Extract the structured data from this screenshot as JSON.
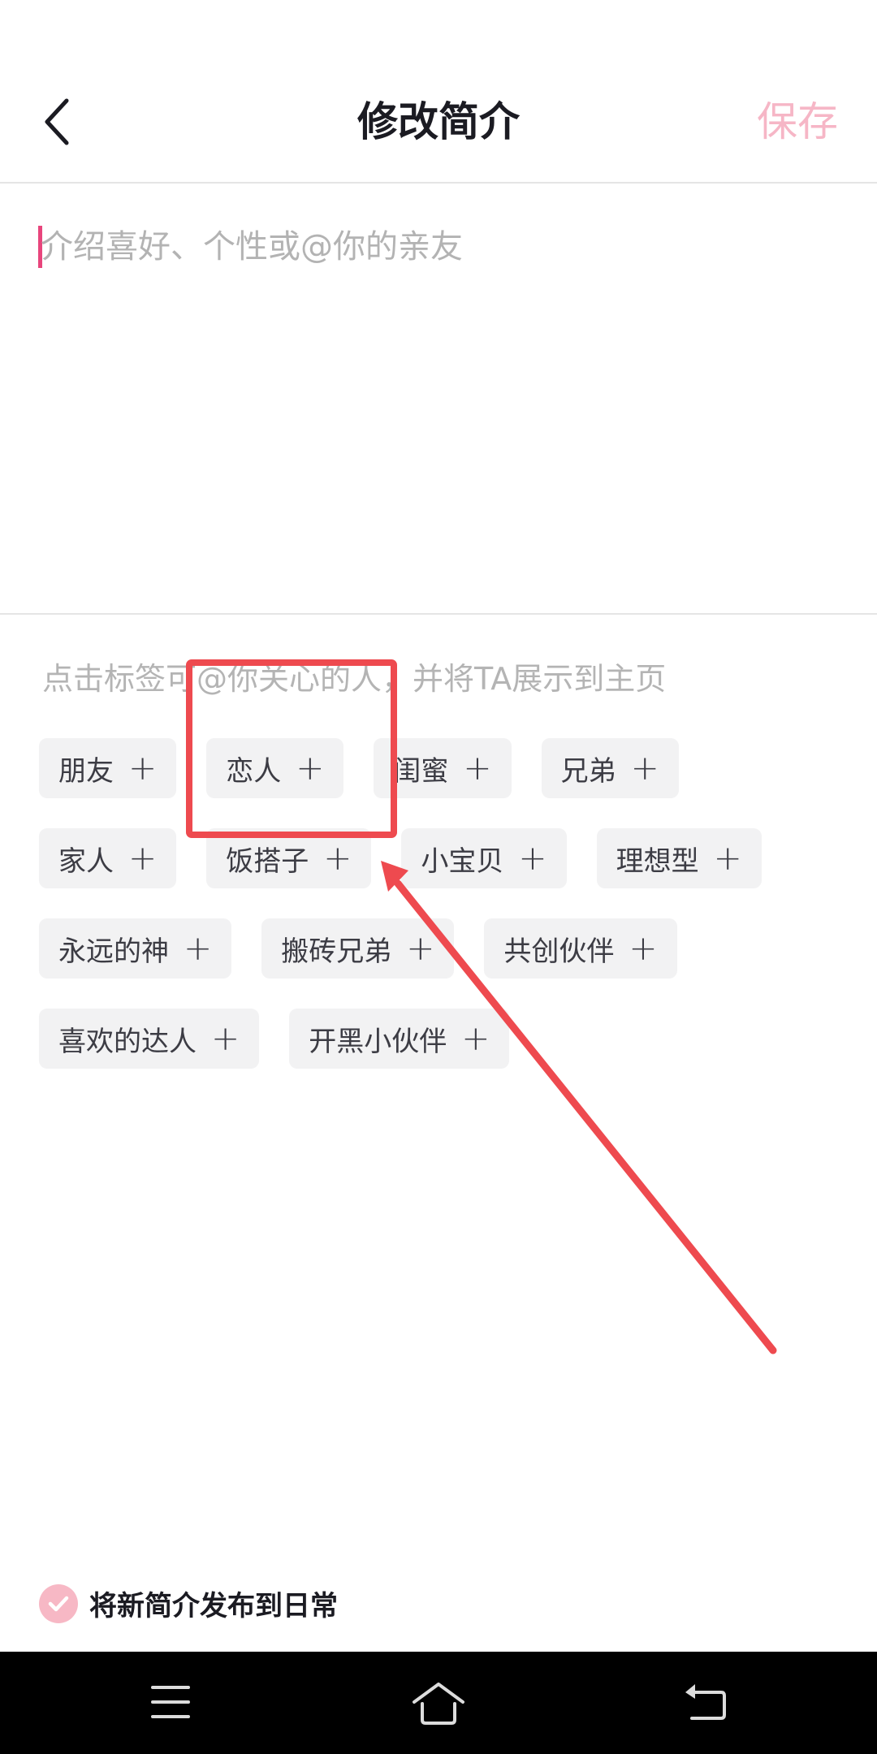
{
  "header": {
    "back_icon": "chevron-left-icon",
    "title": "修改简介",
    "save_label": "保存"
  },
  "editor": {
    "placeholder": "介绍喜好、个性或@你的亲友",
    "value": ""
  },
  "tags_section": {
    "hint": "点击标签可@你关心的人，并将TA展示到主页",
    "add_symbol": "+",
    "rows": [
      [
        {
          "label": "朋友"
        },
        {
          "label": "恋人"
        },
        {
          "label": "闺蜜"
        },
        {
          "label": "兄弟"
        }
      ],
      [
        {
          "label": "家人"
        },
        {
          "label": "饭搭子"
        },
        {
          "label": "小宝贝"
        },
        {
          "label": "理想型"
        }
      ],
      [
        {
          "label": "永远的神"
        },
        {
          "label": "搬砖兄弟"
        },
        {
          "label": "共创伙伴"
        }
      ],
      [
        {
          "label": "喜欢的达人"
        },
        {
          "label": "开黑小伙伴"
        }
      ]
    ]
  },
  "publish_option": {
    "label": "将新简介发布到日常",
    "checked": true
  },
  "system_nav": {
    "items": [
      "menu-icon",
      "home-icon",
      "back-icon"
    ]
  },
  "annotation": {
    "highlighted_tag": "恋人",
    "color": "#ee4a4f"
  },
  "colors": {
    "accent": "#e8457c",
    "save_disabled": "#f6b6c6",
    "tag_bg": "#f2f2f3",
    "check_bg": "#f7b8c5"
  }
}
